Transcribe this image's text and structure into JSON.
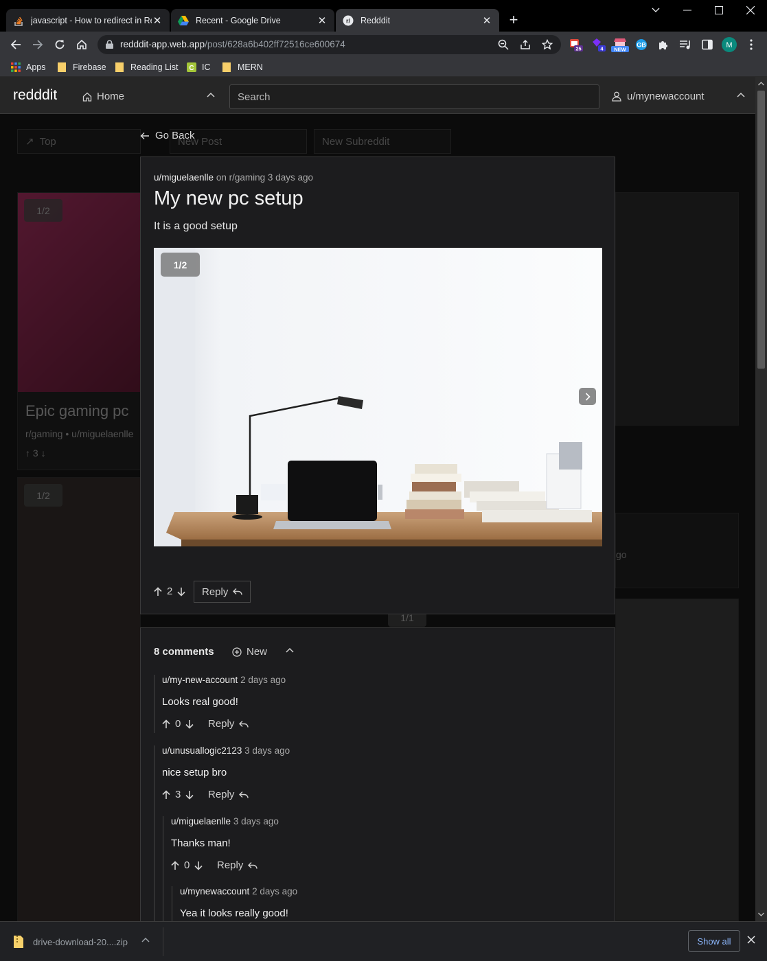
{
  "tabs": [
    {
      "title": "javascript - How to redirect in React",
      "icon": "stackoverflow-icon"
    },
    {
      "title": "Recent - Google Drive",
      "icon": "google-drive-icon"
    },
    {
      "title": "Redddit",
      "icon": "redddit-icon",
      "active": true
    }
  ],
  "address_bar": {
    "host": "redddit-app.web.app",
    "path": "/post/628a6b402ff72516ce600674"
  },
  "extensions": {
    "badge_1": "25",
    "badge_2": "4",
    "badge_3": "NEW",
    "profile_initial": "M"
  },
  "bookmarks": [
    "Apps",
    "Firebase",
    "Reading List",
    "IC",
    "MERN"
  ],
  "app": {
    "logo": "redddit",
    "home_label": "Home",
    "search_placeholder": "Search",
    "user_label": "u/mynewaccount"
  },
  "feed_background": {
    "buttons": [
      "Top",
      "New Post",
      "New Subreddit"
    ],
    "card_badge": "1/2",
    "card_title": "Epic gaming pc",
    "card_sub": "r/gaming",
    "card_author": "u/miguelaenlle",
    "card_votes": "3",
    "card_badge_2": "1/2",
    "card_badge_3": "1/1",
    "card_time": "go"
  },
  "post": {
    "go_back": "Go Back",
    "author": "u/miguelaenlle",
    "on": "on",
    "subreddit": "r/gaming",
    "time": "3 days ago",
    "title": "My new pc setup",
    "body": "It is a good setup",
    "image_counter": "1/2",
    "votes": "2",
    "reply_label": "Reply"
  },
  "comments": {
    "count_label": "8 comments",
    "new_label": "New",
    "items": [
      {
        "author": "u/my-new-account",
        "time": "2 days ago",
        "text": "Looks real good!",
        "votes": "0",
        "reply": "Reply"
      },
      {
        "author": "u/unusuallogic2123",
        "time": "3 days ago",
        "text": "nice setup bro",
        "votes": "3",
        "reply": "Reply"
      },
      {
        "author": "u/miguelaenlle",
        "time": "3 days ago",
        "text": "Thanks man!",
        "votes": "0",
        "reply": "Reply"
      },
      {
        "author": "u/mynewaccount",
        "time": "2 days ago",
        "text": "Yea it looks really good!"
      }
    ]
  },
  "download": {
    "filename": "drive-download-20....zip",
    "show_all": "Show all"
  },
  "colors": {
    "page_bg": "#0b0b0b",
    "panel_bg": "#1c1c1e",
    "accent_link": "#8ab4f8"
  }
}
